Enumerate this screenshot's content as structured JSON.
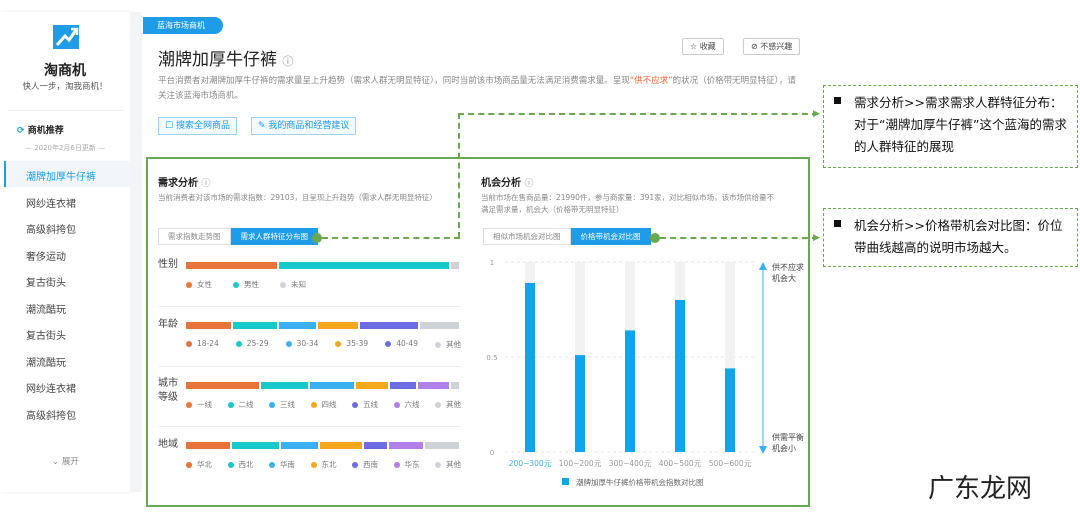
{
  "sidebar": {
    "brand": "淘商机",
    "slogan": "快人一步，淘我商机！",
    "section": "商机推荐",
    "updated": "— 2020年2月6日更新 —",
    "items": [
      "潮牌加厚牛仔裤",
      "网纱连衣裙",
      "高级斜挎包",
      "奢侈运动",
      "复古街头",
      "潮流酷玩",
      "复古街头",
      "潮流酷玩",
      "网纱连衣裙",
      "高级斜挎包"
    ],
    "expand": "展开"
  },
  "header": {
    "tag": "蓝海市场商机",
    "title": "潮牌加厚牛仔裤",
    "favorite": "收藏",
    "not_interested": "不感兴趣",
    "desc_before": "平台消费者对潮牌加厚牛仔裤的需求量呈上升趋势（需求人群无明显特征），同时当前该市场商品量无法满足消费需求量。呈现",
    "desc_highlight": "“供不应求”",
    "desc_after": "的状况（价格带无明显特征），请关注该蓝海市场商机。",
    "search_all": "搜索全网商品",
    "my_advice": "我的商品和经营建议"
  },
  "demand": {
    "title": "需求分析",
    "desc": "当前消费者对该市场的需求指数：29103，且呈现上升趋势（需求人群无明显特征）",
    "tabs": [
      "需求指数走势图",
      "需求人群特征分布图"
    ],
    "rows": [
      {
        "label": "性别",
        "segments": [
          {
            "name": "女性",
            "color": "#e8743b",
            "share": 0.34
          },
          {
            "name": "男性",
            "color": "#19c8c8",
            "share": 0.63
          },
          {
            "name": "未知",
            "color": "#cfd3d8",
            "share": 0.03
          }
        ]
      },
      {
        "label": "年龄",
        "segments": [
          {
            "name": "18-24",
            "color": "#e8743b",
            "share": 0.17
          },
          {
            "name": "25-29",
            "color": "#19c8c8",
            "share": 0.17
          },
          {
            "name": "30-34",
            "color": "#3ab0ee",
            "share": 0.14
          },
          {
            "name": "35-39",
            "color": "#f4a81d",
            "share": 0.15
          },
          {
            "name": "40-49",
            "color": "#6d6ce0",
            "share": 0.22
          },
          {
            "name": "其他",
            "color": "#cfd3d8",
            "share": 0.15
          }
        ]
      },
      {
        "label": "城市等级",
        "segments": [
          {
            "name": "一线",
            "color": "#e8743b",
            "share": 0.28
          },
          {
            "name": "二线",
            "color": "#19c8c8",
            "share": 0.18
          },
          {
            "name": "三线",
            "color": "#3ab0ee",
            "share": 0.17
          },
          {
            "name": "四线",
            "color": "#f4a81d",
            "share": 0.12
          },
          {
            "name": "五线",
            "color": "#6d6ce0",
            "share": 0.1
          },
          {
            "name": "六线",
            "color": "#b07fe8",
            "share": 0.12
          },
          {
            "name": "其他",
            "color": "#cfd3d8",
            "share": 0.03
          }
        ]
      },
      {
        "label": "地域",
        "segments": [
          {
            "name": "华北",
            "color": "#e8743b",
            "share": 0.17
          },
          {
            "name": "西北",
            "color": "#19c8c8",
            "share": 0.18
          },
          {
            "name": "华南",
            "color": "#3ab0ee",
            "share": 0.14
          },
          {
            "name": "东北",
            "color": "#f4a81d",
            "share": 0.16
          },
          {
            "name": "西南",
            "color": "#6d6ce0",
            "share": 0.09
          },
          {
            "name": "华东",
            "color": "#b07fe8",
            "share": 0.13
          },
          {
            "name": "其他",
            "color": "#cfd3d8",
            "share": 0.13
          }
        ]
      }
    ]
  },
  "opportunity": {
    "title": "机会分析",
    "desc": "当前市场在售商品量：21990件，参与商家量：391家，对比相似市场，该市场供给量不满足需求量，机会大（价格带无明显特征）",
    "tabs": [
      "相似市场机会对比图",
      "价格带机会对比图"
    ]
  },
  "chart_data": {
    "type": "bar",
    "categories": [
      "200~300元",
      "100~200元",
      "300~400元",
      "400~500元",
      "500~600元"
    ],
    "series": [
      {
        "name": "潮牌加厚牛仔裤价格带机会指数对比图",
        "values": [
          0.89,
          0.51,
          0.64,
          0.8,
          0.44
        ],
        "color": "#0ea5ec"
      }
    ],
    "ylim": [
      0,
      1
    ],
    "yticks": [
      "0",
      "0.5",
      "1"
    ],
    "top_label": "供不应求机会大",
    "bottom_label": "供需平衡机会小",
    "grid": true,
    "legend": "bottom"
  },
  "annotations": [
    "需求分析>>需求需求人群特征分布：对于“潮牌加厚牛仔裤”这个蓝海的需求的人群特征的展现",
    "机会分析>>价格带机会对比图：价位带曲线越高的说明市场越大。"
  ],
  "watermark": "广东龙网"
}
